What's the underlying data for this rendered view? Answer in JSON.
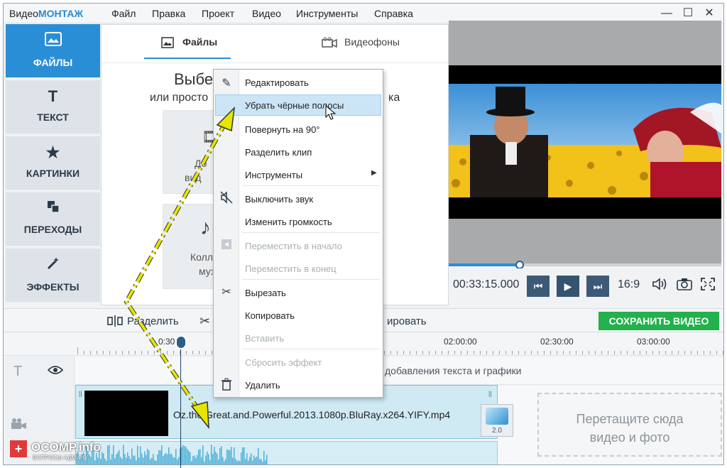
{
  "app": {
    "logo_prefix": "Видео",
    "logo_brand": "МОНТАЖ",
    "menu": [
      "Файл",
      "Правка",
      "Проект",
      "Видео",
      "Инструменты",
      "Справка"
    ]
  },
  "window_controls": {
    "minimize": "—",
    "maximize": "☐",
    "close": "✕"
  },
  "left_nav": [
    {
      "label": "ФАЙЛЫ",
      "icon": "image-icon",
      "active": true
    },
    {
      "label": "ТЕКСТ",
      "icon": "text-icon"
    },
    {
      "label": "КАРТИНКИ",
      "icon": "star-icon"
    },
    {
      "label": "ПЕРЕХОДЫ",
      "icon": "transitions-icon"
    },
    {
      "label": "ЭФФЕКТЫ",
      "icon": "magic-wand-icon"
    }
  ],
  "files_panel": {
    "tabs": [
      {
        "label": "Файлы",
        "active": true
      },
      {
        "label": "Видеофоны"
      }
    ],
    "heading_visible": "Выбе",
    "sub_visible_left": "или просто",
    "sub_visible_right": "ка",
    "tile1_line1": "До",
    "tile1_line2": "вид",
    "tile2_line1": "Колл",
    "tile2_line2": "муз"
  },
  "player": {
    "timecode": "00:33:15.000",
    "aspect": "16:9",
    "progress_fraction": 0.27
  },
  "toolbar": {
    "split_label": "Разделить",
    "copy_partial": "ировать",
    "save_label": "СОХРАНИТЬ ВИДЕО"
  },
  "ruler": {
    "labels": [
      "0:30",
      "02:00:00",
      "02:30:00",
      "03:00:00"
    ]
  },
  "timeline": {
    "text_track_hint": "добавления текста и графики",
    "clip_title": "Oz.the.Great.and.Powerful.2013.1080p.BluRay.x264.YIFY.mp4",
    "transition_duration": "2.0",
    "drop_line1": "Перетащите сюда",
    "drop_line2": "видео и фото"
  },
  "context_menu": {
    "items": [
      {
        "label": "Редактировать",
        "icon": "pencil-icon",
        "disabled": false
      },
      {
        "label": "Убрать чёрные полосы",
        "icon": "",
        "disabled": false,
        "highlighted": true
      },
      {
        "label": "Повернуть на 90°",
        "icon": "",
        "disabled": false
      },
      {
        "label": "Разделить клип",
        "icon": "",
        "disabled": false
      },
      {
        "label": "Инструменты",
        "icon": "",
        "disabled": false,
        "submenu": true
      },
      {
        "label": "Выключить звук",
        "icon": "mute-icon",
        "disabled": false
      },
      {
        "label": "Изменить громкость",
        "icon": "",
        "disabled": false
      },
      {
        "label": "Переместить в начало",
        "icon": "move-start-icon",
        "disabled": true
      },
      {
        "label": "Переместить в конец",
        "icon": "",
        "disabled": true
      },
      {
        "label": "Вырезать",
        "icon": "scissors-icon",
        "disabled": false
      },
      {
        "label": "Копировать",
        "icon": "",
        "disabled": false
      },
      {
        "label": "Вставить",
        "icon": "",
        "disabled": true
      },
      {
        "label": "Сбросить эффект",
        "icon": "",
        "disabled": true
      },
      {
        "label": "Удалить",
        "icon": "trash-icon",
        "disabled": false
      }
    ]
  },
  "watermark": {
    "brand": "OCOMP.info",
    "tagline": "ВОПРОСЫ АДМИНУ"
  },
  "colors": {
    "accent": "#2a8ed6",
    "save": "#22b14c",
    "menu_highlight": "#cbe5f6",
    "annotation_arrow": "#e6e600"
  }
}
